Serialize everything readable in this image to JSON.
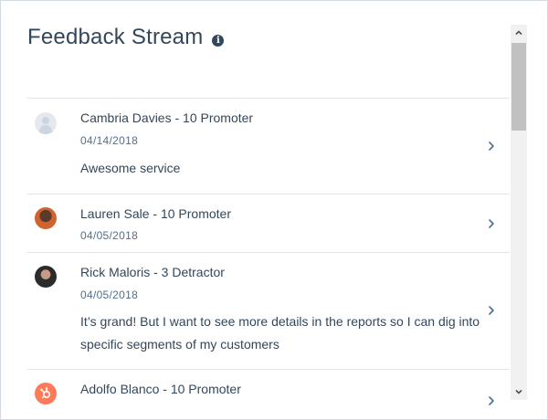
{
  "header": {
    "title": "Feedback Stream",
    "info_icon": "info-icon"
  },
  "feedback": [
    {
      "name": "Cambria Davies - 10 Promoter",
      "date": "04/14/2018",
      "comment": "Awesome service",
      "avatar": "default-avatar"
    },
    {
      "name": "Lauren Sale - 10 Promoter",
      "date": "04/05/2018",
      "comment": "",
      "avatar": "photo"
    },
    {
      "name": "Rick Maloris - 3 Detractor",
      "date": "04/05/2018",
      "comment": "It’s grand! But I want to see more details in the reports so I can dig into specific segments of my customers",
      "avatar": "photo"
    },
    {
      "name": "Adolfo Blanco - 10 Promoter",
      "date": "",
      "comment": "",
      "avatar": "hubspot-sprocket"
    }
  ],
  "colors": {
    "text": "#33475b",
    "secondary": "#516f90",
    "divider": "#dfe3eb",
    "accent": "#ff7a59"
  }
}
